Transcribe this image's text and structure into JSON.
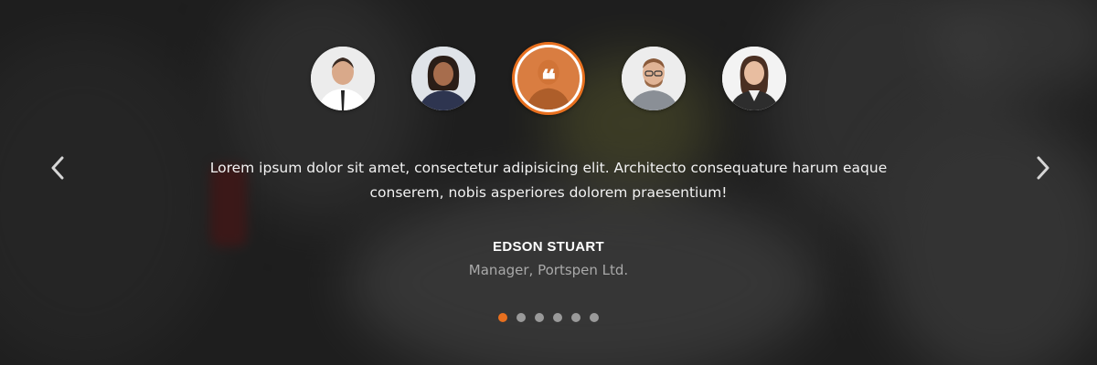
{
  "testimonial": {
    "quote": "Lorem ipsum dolor sit amet, consectetur adipisicing elit. Architecto consequature harum eaque conserem, nobis asperiores dolorem praesentium!",
    "author_name": "EDSON STUART",
    "author_role": "Manager, Portspen Ltd."
  },
  "avatars": [
    {
      "icon": "person-avatar-icon",
      "active": false
    },
    {
      "icon": "person-avatar-icon",
      "active": false
    },
    {
      "icon": "quote-icon",
      "active": true
    },
    {
      "icon": "person-avatar-icon",
      "active": false
    },
    {
      "icon": "person-avatar-icon",
      "active": false
    }
  ],
  "navigation": {
    "prev_icon": "chevron-left-icon",
    "next_icon": "chevron-right-icon"
  },
  "pagination": {
    "count": 6,
    "active_index": 0
  },
  "colors": {
    "accent": "#e8701f",
    "text": "#f2f2f2",
    "muted": "#a9a9a9",
    "dot_inactive": "#9a9a9a"
  }
}
